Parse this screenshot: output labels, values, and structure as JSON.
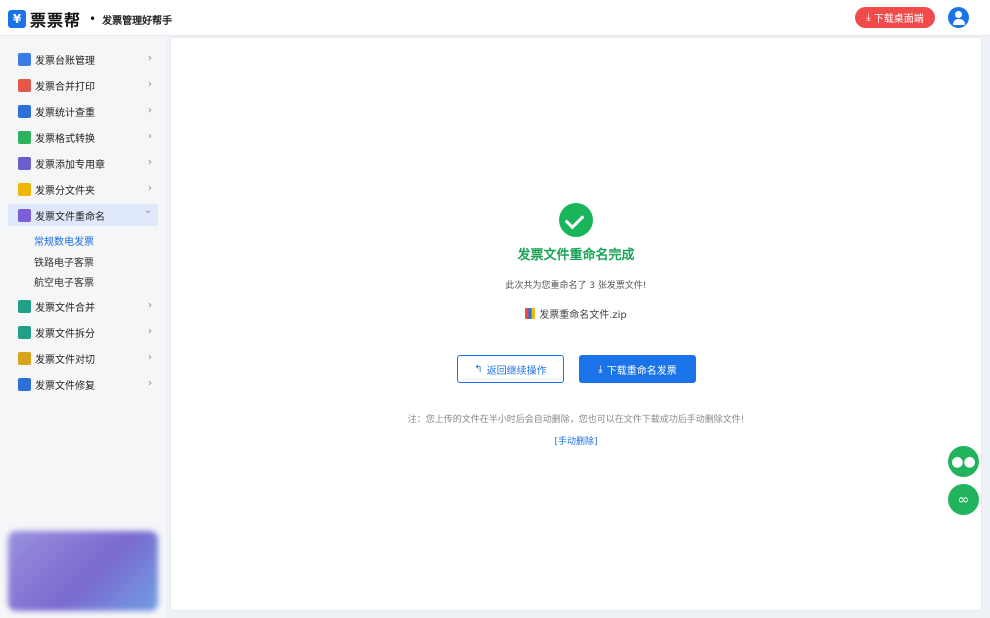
{
  "header": {
    "logo_mark": "¥",
    "logo_text": "票票帮",
    "logo_dot": "•",
    "subtitle": "发票管理好帮手",
    "download_desktop": "下载桌面端",
    "download_icon": "download-icon",
    "brand_color": "#1a73e8",
    "download_color": "#f04a4a"
  },
  "sidebar": {
    "items": [
      {
        "label": "发票台账管理",
        "icon": "ledger-icon",
        "color": "#3d7be6"
      },
      {
        "label": "发票合并打印",
        "icon": "printer-icon",
        "color": "#e4574b"
      },
      {
        "label": "发票统计查重",
        "icon": "stats-icon",
        "color": "#2f6fd9"
      },
      {
        "label": "发票格式转换",
        "icon": "convert-icon",
        "color": "#2eb15c"
      },
      {
        "label": "发票添加专用章",
        "icon": "stamp-icon",
        "color": "#6b5fd0"
      },
      {
        "label": "发票分文件夹",
        "icon": "folder-icon",
        "color": "#f2b705"
      },
      {
        "label": "发票文件重命名",
        "icon": "rename-icon",
        "color": "#7a5fd8"
      },
      {
        "label": "发票文件合并",
        "icon": "merge-icon",
        "color": "#22a087"
      },
      {
        "label": "发票文件拆分",
        "icon": "split-icon",
        "color": "#22a087"
      },
      {
        "label": "发票文件对切",
        "icon": "cut-icon",
        "color": "#d9a21d"
      },
      {
        "label": "发票文件修复",
        "icon": "repair-icon",
        "color": "#2f6fd9"
      }
    ],
    "sub_items": [
      "常规数电发票",
      "铁路电子客票",
      "航空电子客票"
    ],
    "arrow_right": "›",
    "arrow_down": "⌄"
  },
  "main": {
    "title": "发票文件重命名完成",
    "summary": "此次共为您重命名了 3 张发票文件!",
    "zip_name": "发票重命名文件.zip",
    "back_button": "返回继续操作",
    "download_button": "下载重命名发票",
    "note": "注：您上传的文件在半小时后会自动删除，您也可以在文件下载成功后手动删除文件!",
    "manual_delete": "[手动删除]",
    "success_color": "#19b55a"
  },
  "floating": {
    "wechat_icon": "wechat-icon",
    "link_icon": "link-icon"
  }
}
